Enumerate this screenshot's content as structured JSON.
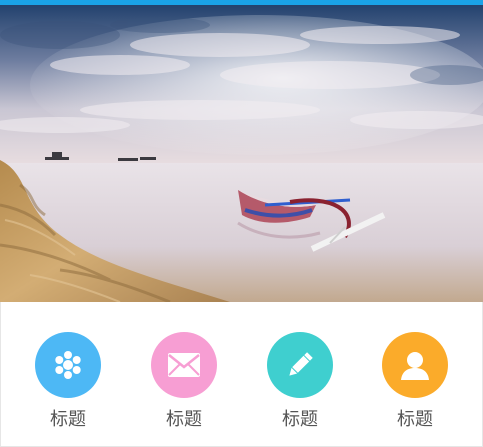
{
  "colors": {
    "top_bar": "#1aa3e8",
    "nav_1": "#4db8f5",
    "nav_2": "#f79ed3",
    "nav_3": "#3fcfcf",
    "nav_4": "#fbab2a",
    "label": "#555555"
  },
  "banner": {
    "image": "beach-boat-photo"
  },
  "nav": {
    "items": [
      {
        "icon": "asterisk-icon",
        "label": "标题"
      },
      {
        "icon": "mail-icon",
        "label": "标题"
      },
      {
        "icon": "pencil-icon",
        "label": "标题"
      },
      {
        "icon": "user-icon",
        "label": "标题"
      }
    ]
  }
}
